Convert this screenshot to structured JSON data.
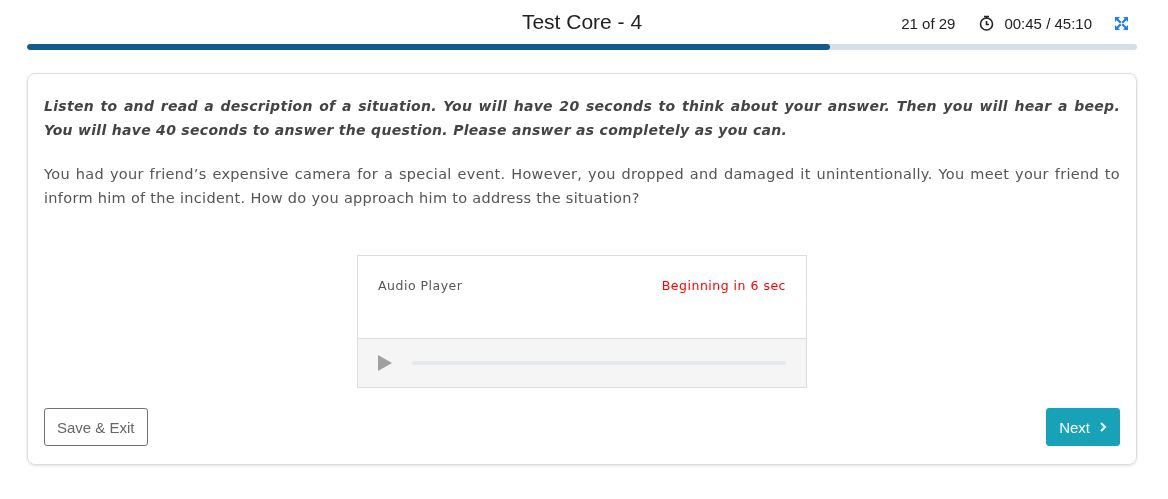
{
  "header": {
    "title": "Test Core - 4",
    "counter": "21 of 29",
    "timer": "00:45 / 45:10",
    "progress": {
      "level": 0.723
    }
  },
  "question": {
    "instructions": "Listen to and read a description of a situation. You will have 20 seconds to think about your answer. Then you will hear a beep. You will have 40 seconds to answer the question. Please answer as completely as you can.",
    "prompt": "You had your friend’s expensive camera for a special event. However, you dropped and damaged it unintentionally. You meet your friend to inform him of the incident. How do you approach him to address the situation?"
  },
  "audio_player": {
    "title": "Audio Player",
    "status": "Beginning in 6 sec"
  },
  "buttons": [
    {
      "kind": "secondary",
      "label": "Save & Exit"
    },
    {
      "kind": "primary",
      "label": "Next"
    }
  ]
}
